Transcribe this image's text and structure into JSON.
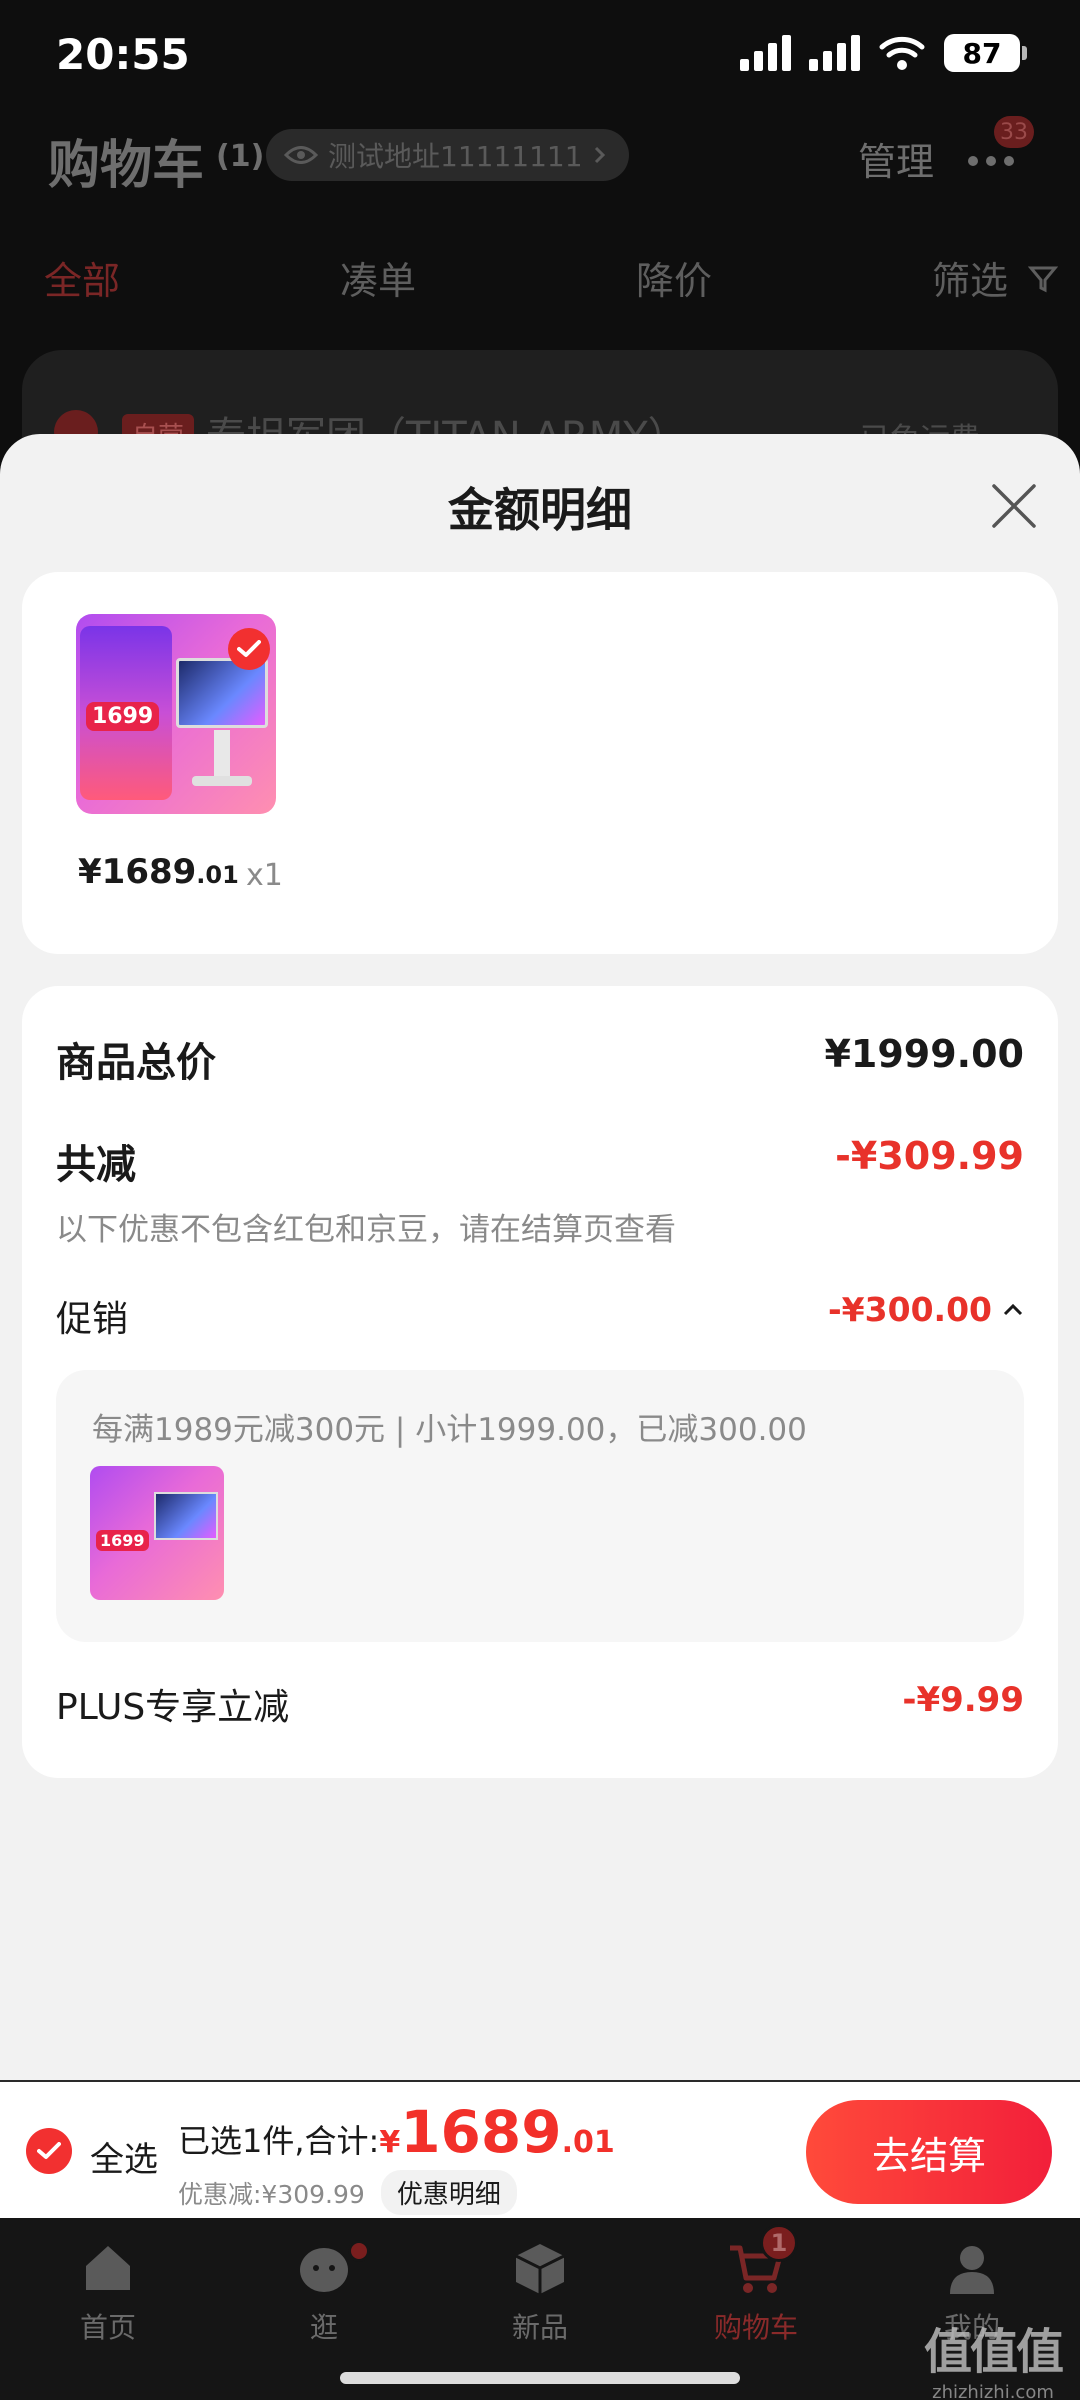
{
  "status_bar": {
    "time": "20:55",
    "battery": "87"
  },
  "header": {
    "title": "购物车",
    "count": "(1)",
    "address": "测试地址11111111",
    "manage_label": "管理",
    "more_badge": "33"
  },
  "filter_tabs": [
    {
      "label": "全部",
      "active": true
    },
    {
      "label": "凑单"
    },
    {
      "label": "降价"
    },
    {
      "label": "筛选"
    }
  ],
  "background_store": {
    "tag": "自营",
    "name": "泰坦军团（TITAN ARMY）",
    "freight": "已免运费"
  },
  "sheet": {
    "title": "金额明细",
    "item": {
      "price_int": "¥1689",
      "price_dec": ".01",
      "qty": "x1",
      "thumb_promo_price": "1699"
    },
    "details": {
      "subtotal_label": "商品总价",
      "subtotal_value": "¥1999.00",
      "reduce_label": "共减",
      "reduce_value": "-¥309.99",
      "reduce_note": "以下优惠不包含红包和京豆，请在结算页查看",
      "promo_label": "促销",
      "promo_value": "-¥300.00",
      "promo_rule": "每满1989元减300元 | 小计1999.00，已减300.00",
      "plus_label": "PLUS专享立减",
      "plus_value": "-¥9.99"
    }
  },
  "checkout": {
    "select_all": "全选",
    "summary": "已选1件,合计:",
    "total_currency": "¥",
    "total_int": "1689",
    "total_dec": ".01",
    "discount": "优惠减:¥309.99",
    "detail_label": "优惠明细",
    "checkout_label": "去结算"
  },
  "tab_bar": {
    "tabs": [
      {
        "label": "首页",
        "icon": "home-icon"
      },
      {
        "label": "逛",
        "icon": "browse-icon"
      },
      {
        "label": "新品",
        "icon": "new-products-icon"
      },
      {
        "label": "购物车",
        "icon": "cart-icon",
        "active": true,
        "badge": "1"
      },
      {
        "label": "我的",
        "icon": "profile-icon"
      }
    ]
  },
  "watermark": {
    "logo": "值值值",
    "url": "zhizhizhi.com"
  },
  "colors": {
    "accent": "#f23030",
    "price_red": "#e8322a",
    "sheet_bg": "#f2f2f2"
  }
}
